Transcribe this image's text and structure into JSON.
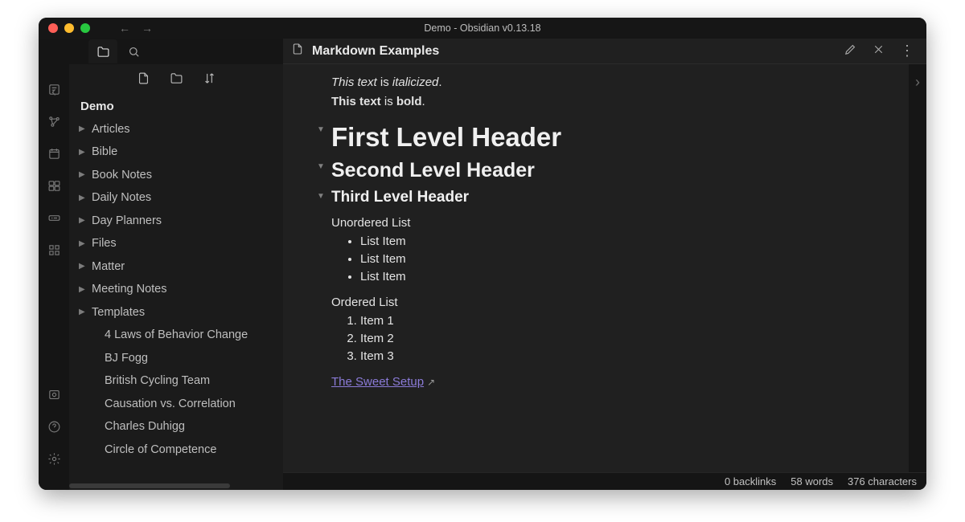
{
  "window": {
    "title": "Demo - Obsidian v0.13.18"
  },
  "sidebar": {
    "vault": "Demo",
    "folders": [
      "Articles",
      "Bible",
      "Book Notes",
      "Daily Notes",
      "Day Planners",
      "Files",
      "Matter",
      "Meeting Notes",
      "Templates"
    ],
    "files": [
      "4 Laws of Behavior Change",
      "BJ Fogg",
      "British Cycling Team",
      "Causation vs. Correlation",
      "Charles Duhigg",
      "Circle of Competence"
    ]
  },
  "tab": {
    "title": "Markdown Examples"
  },
  "doc": {
    "line_italic_pre": "This text",
    "line_italic_mid": " is ",
    "line_italic_em": "italicized",
    "line_italic_post": ".",
    "line_bold_pre": "This text",
    "line_bold_mid": " is ",
    "line_bold_b": "bold",
    "line_bold_post": ".",
    "h1": "First Level Header",
    "h2": "Second Level Header",
    "h3": "Third Level Header",
    "ul_label": "Unordered List",
    "ul_items": [
      "List Item",
      "List Item",
      "List Item"
    ],
    "ol_label": "Ordered List",
    "ol_items": [
      "Item 1",
      "Item 2",
      "Item 3"
    ],
    "link_text": "The Sweet Setup"
  },
  "status": {
    "backlinks": "0 backlinks",
    "words": "58 words",
    "chars": "376 characters"
  }
}
